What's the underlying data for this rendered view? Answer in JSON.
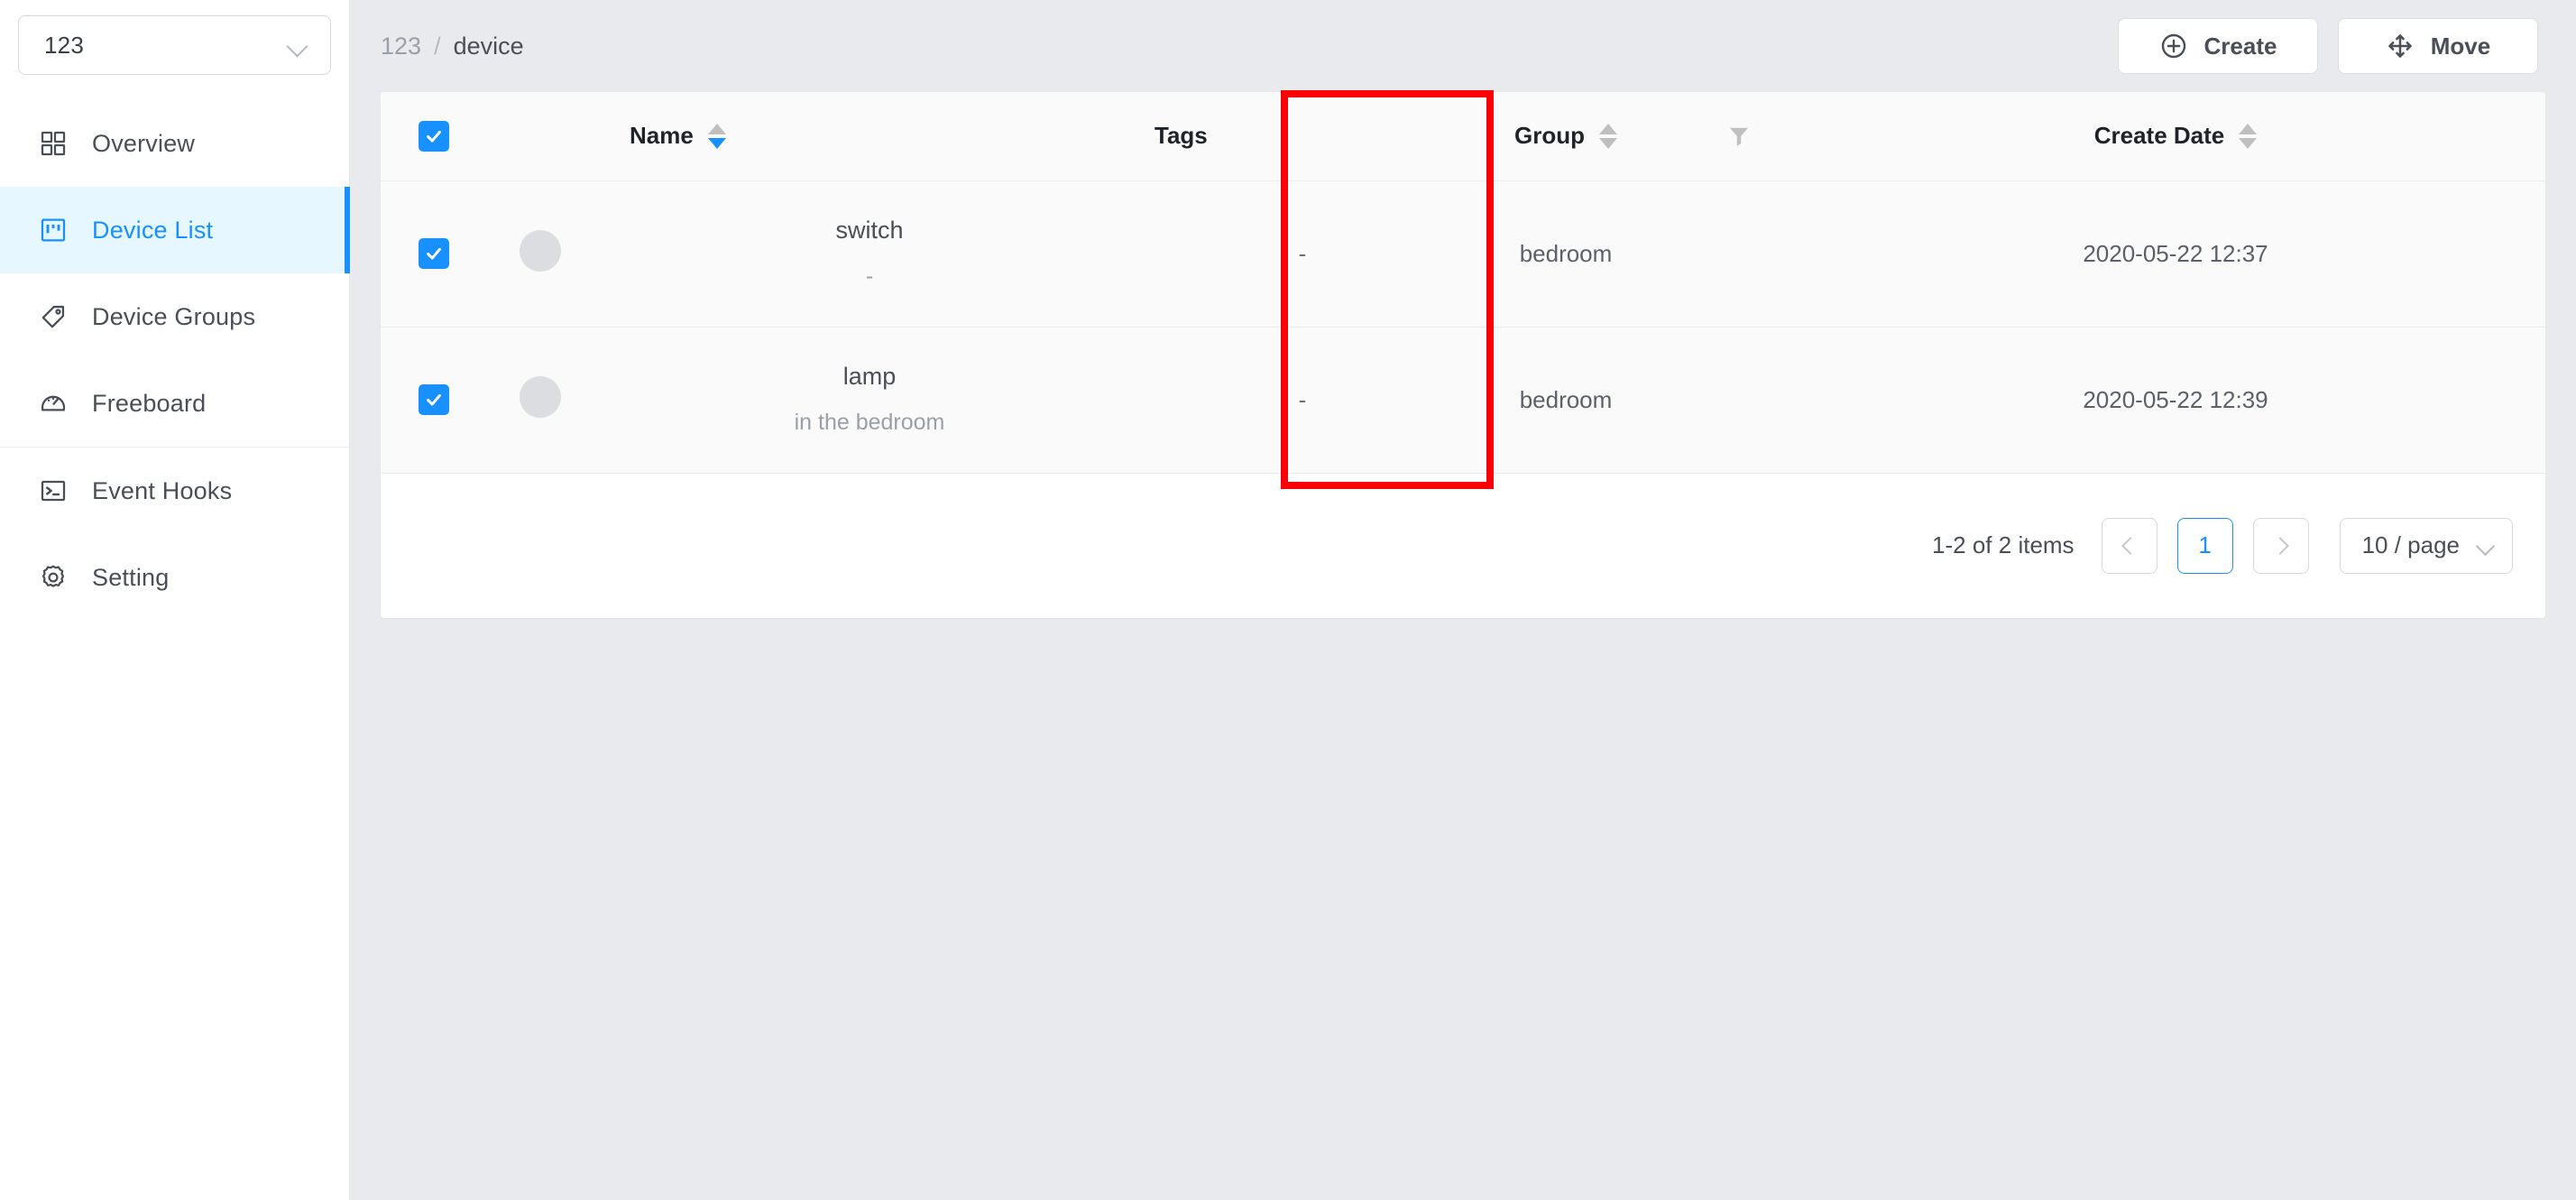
{
  "sidebar": {
    "org_select": {
      "value": "123",
      "icon": "chevron-down-icon"
    },
    "items": [
      {
        "label": "Overview",
        "icon": "grid-icon",
        "active": false
      },
      {
        "label": "Device List",
        "icon": "kanban-icon",
        "active": true
      },
      {
        "label": "Device Groups",
        "icon": "tag-icon",
        "active": false
      },
      {
        "label": "Freeboard",
        "icon": "dashboard-icon",
        "active": false
      },
      {
        "label": "Event Hooks",
        "icon": "terminal-icon",
        "active": false
      },
      {
        "label": "Setting",
        "icon": "gear-icon",
        "active": false
      }
    ]
  },
  "topbar": {
    "breadcrumb": {
      "root": "123",
      "separator": "/",
      "current": "device"
    },
    "create_label": "Create",
    "create_icon": "plus-circle-icon",
    "move_label": "Move",
    "move_icon": "move-arrows-icon"
  },
  "table": {
    "select_all_checked": true,
    "columns": [
      {
        "key": "check",
        "label": "",
        "sortable": false
      },
      {
        "key": "avatar",
        "label": "",
        "sortable": false
      },
      {
        "key": "name",
        "label": "Name",
        "sortable": true,
        "sort": "desc"
      },
      {
        "key": "tags",
        "label": "Tags",
        "sortable": false
      },
      {
        "key": "group",
        "label": "Group",
        "sortable": true,
        "sort": "none"
      },
      {
        "key": "filter",
        "label": "",
        "sortable": false,
        "icon": "filter-icon"
      },
      {
        "key": "date",
        "label": "Create Date",
        "sortable": true,
        "sort": "none"
      }
    ],
    "rows": [
      {
        "checked": true,
        "name": "switch",
        "description": "-",
        "tags": "-",
        "group": "bedroom",
        "create_date": "2020-05-22 12:37"
      },
      {
        "checked": true,
        "name": "lamp",
        "description": "in the bedroom",
        "tags": "-",
        "group": "bedroom",
        "create_date": "2020-05-22 12:39"
      }
    ]
  },
  "pagination": {
    "total_text": "1-2 of 2 items",
    "prev_label": "",
    "current_page": "1",
    "next_label": "",
    "page_size": "10 / page",
    "page_size_icon": "chevron-down-icon"
  },
  "annotation": {
    "highlight_color": "#fb0007",
    "target": "Group column"
  }
}
